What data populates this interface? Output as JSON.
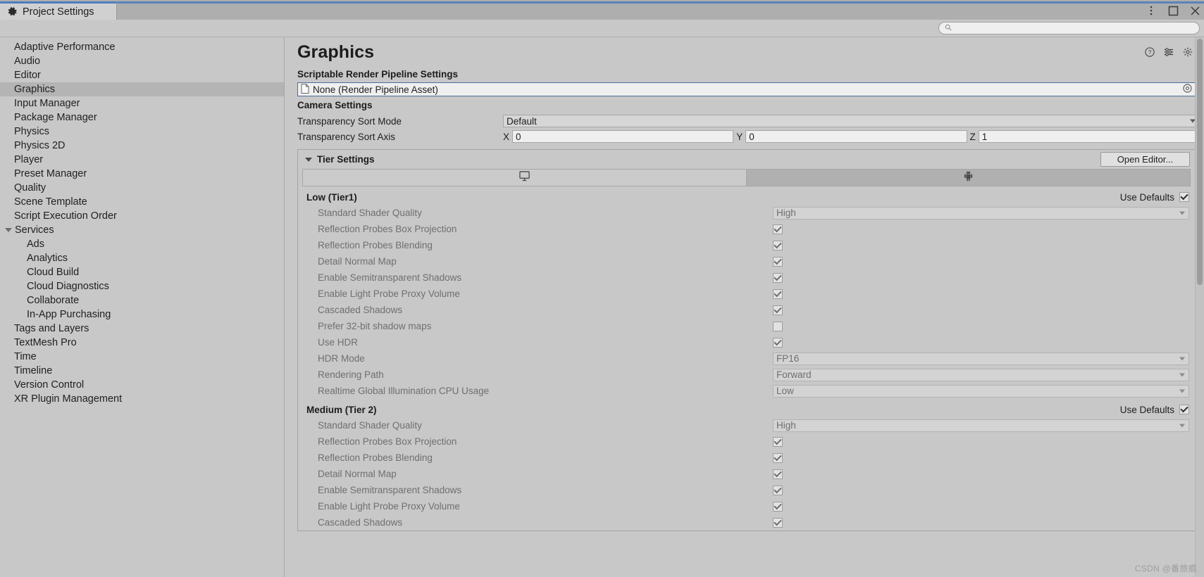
{
  "window": {
    "tab_label": "Project Settings",
    "tab_icon": "gear-icon",
    "controls": [
      {
        "name": "more-options-icon",
        "glyph": "kebab"
      },
      {
        "name": "maximize-icon",
        "glyph": "square"
      },
      {
        "name": "close-icon",
        "glyph": "x"
      }
    ]
  },
  "search": {
    "value": "",
    "placeholder": "",
    "icon": "search-icon"
  },
  "sidebar": {
    "items": [
      {
        "label": "Adaptive Performance",
        "level": 0,
        "selected": false,
        "expander": false
      },
      {
        "label": "Audio",
        "level": 0,
        "selected": false,
        "expander": false
      },
      {
        "label": "Editor",
        "level": 0,
        "selected": false,
        "expander": false
      },
      {
        "label": "Graphics",
        "level": 0,
        "selected": true,
        "expander": false
      },
      {
        "label": "Input Manager",
        "level": 0,
        "selected": false,
        "expander": false
      },
      {
        "label": "Package Manager",
        "level": 0,
        "selected": false,
        "expander": false
      },
      {
        "label": "Physics",
        "level": 0,
        "selected": false,
        "expander": false
      },
      {
        "label": "Physics 2D",
        "level": 0,
        "selected": false,
        "expander": false
      },
      {
        "label": "Player",
        "level": 0,
        "selected": false,
        "expander": false
      },
      {
        "label": "Preset Manager",
        "level": 0,
        "selected": false,
        "expander": false
      },
      {
        "label": "Quality",
        "level": 0,
        "selected": false,
        "expander": false
      },
      {
        "label": "Scene Template",
        "level": 0,
        "selected": false,
        "expander": false
      },
      {
        "label": "Script Execution Order",
        "level": 0,
        "selected": false,
        "expander": false
      },
      {
        "label": "Services",
        "level": 0,
        "selected": false,
        "expander": true
      },
      {
        "label": "Ads",
        "level": 1,
        "selected": false,
        "expander": false
      },
      {
        "label": "Analytics",
        "level": 1,
        "selected": false,
        "expander": false
      },
      {
        "label": "Cloud Build",
        "level": 1,
        "selected": false,
        "expander": false
      },
      {
        "label": "Cloud Diagnostics",
        "level": 1,
        "selected": false,
        "expander": false
      },
      {
        "label": "Collaborate",
        "level": 1,
        "selected": false,
        "expander": false
      },
      {
        "label": "In-App Purchasing",
        "level": 1,
        "selected": false,
        "expander": false
      },
      {
        "label": "Tags and Layers",
        "level": 0,
        "selected": false,
        "expander": false
      },
      {
        "label": "TextMesh Pro",
        "level": 0,
        "selected": false,
        "expander": false
      },
      {
        "label": "Time",
        "level": 0,
        "selected": false,
        "expander": false
      },
      {
        "label": "Timeline",
        "level": 0,
        "selected": false,
        "expander": false
      },
      {
        "label": "Version Control",
        "level": 0,
        "selected": false,
        "expander": false
      },
      {
        "label": "XR Plugin Management",
        "level": 0,
        "selected": false,
        "expander": false
      }
    ]
  },
  "main": {
    "title": "Graphics",
    "header_icons": [
      {
        "name": "help-icon",
        "glyph": "?"
      },
      {
        "name": "preset-icon",
        "glyph": "preset"
      },
      {
        "name": "settings-gear-icon",
        "glyph": "gear"
      }
    ],
    "srp": {
      "section_label": "Scriptable Render Pipeline Settings",
      "asset_value": "None (Render Pipeline Asset)",
      "asset_icon": "document-icon",
      "picker_icon": "object-picker-icon"
    },
    "camera": {
      "section_label": "Camera Settings",
      "sort_mode": {
        "label": "Transparency Sort Mode",
        "value": "Default"
      },
      "sort_axis": {
        "label": "Transparency Sort Axis",
        "x_label": "X",
        "x_value": "0",
        "y_label": "Y",
        "y_value": "0",
        "z_label": "Z",
        "z_value": "1"
      }
    },
    "tier_settings": {
      "title": "Tier Settings",
      "open_editor_label": "Open Editor...",
      "platform_tabs": [
        {
          "name": "tab-standalone",
          "icon": "desktop-monitor-icon",
          "active": false
        },
        {
          "name": "tab-android",
          "icon": "android-robot-icon",
          "active": true
        }
      ],
      "use_defaults_label": "Use Defaults",
      "tiers": [
        {
          "name": "Low (Tier1)",
          "use_defaults": true,
          "rows": [
            {
              "label": "Standard Shader Quality",
              "type": "dropdown",
              "value": "High"
            },
            {
              "label": "Reflection Probes Box Projection",
              "type": "checkbox",
              "checked": true
            },
            {
              "label": "Reflection Probes Blending",
              "type": "checkbox",
              "checked": true
            },
            {
              "label": "Detail Normal Map",
              "type": "checkbox",
              "checked": true
            },
            {
              "label": "Enable Semitransparent Shadows",
              "type": "checkbox",
              "checked": true
            },
            {
              "label": "Enable Light Probe Proxy Volume",
              "type": "checkbox",
              "checked": true
            },
            {
              "label": "Cascaded Shadows",
              "type": "checkbox",
              "checked": true
            },
            {
              "label": "Prefer 32-bit shadow maps",
              "type": "checkbox",
              "checked": false
            },
            {
              "label": "Use HDR",
              "type": "checkbox",
              "checked": true
            },
            {
              "label": "HDR Mode",
              "type": "dropdown",
              "value": "FP16"
            },
            {
              "label": "Rendering Path",
              "type": "dropdown",
              "value": "Forward"
            },
            {
              "label": "Realtime Global Illumination CPU Usage",
              "type": "dropdown",
              "value": "Low"
            }
          ]
        },
        {
          "name": "Medium (Tier 2)",
          "use_defaults": true,
          "rows": [
            {
              "label": "Standard Shader Quality",
              "type": "dropdown",
              "value": "High"
            },
            {
              "label": "Reflection Probes Box Projection",
              "type": "checkbox",
              "checked": true
            },
            {
              "label": "Reflection Probes Blending",
              "type": "checkbox",
              "checked": true
            },
            {
              "label": "Detail Normal Map",
              "type": "checkbox",
              "checked": true
            },
            {
              "label": "Enable Semitransparent Shadows",
              "type": "checkbox",
              "checked": true
            },
            {
              "label": "Enable Light Probe Proxy Volume",
              "type": "checkbox",
              "checked": true
            },
            {
              "label": "Cascaded Shadows",
              "type": "checkbox",
              "checked": true
            }
          ]
        }
      ]
    }
  },
  "watermark": "CSDN @番旅痕"
}
